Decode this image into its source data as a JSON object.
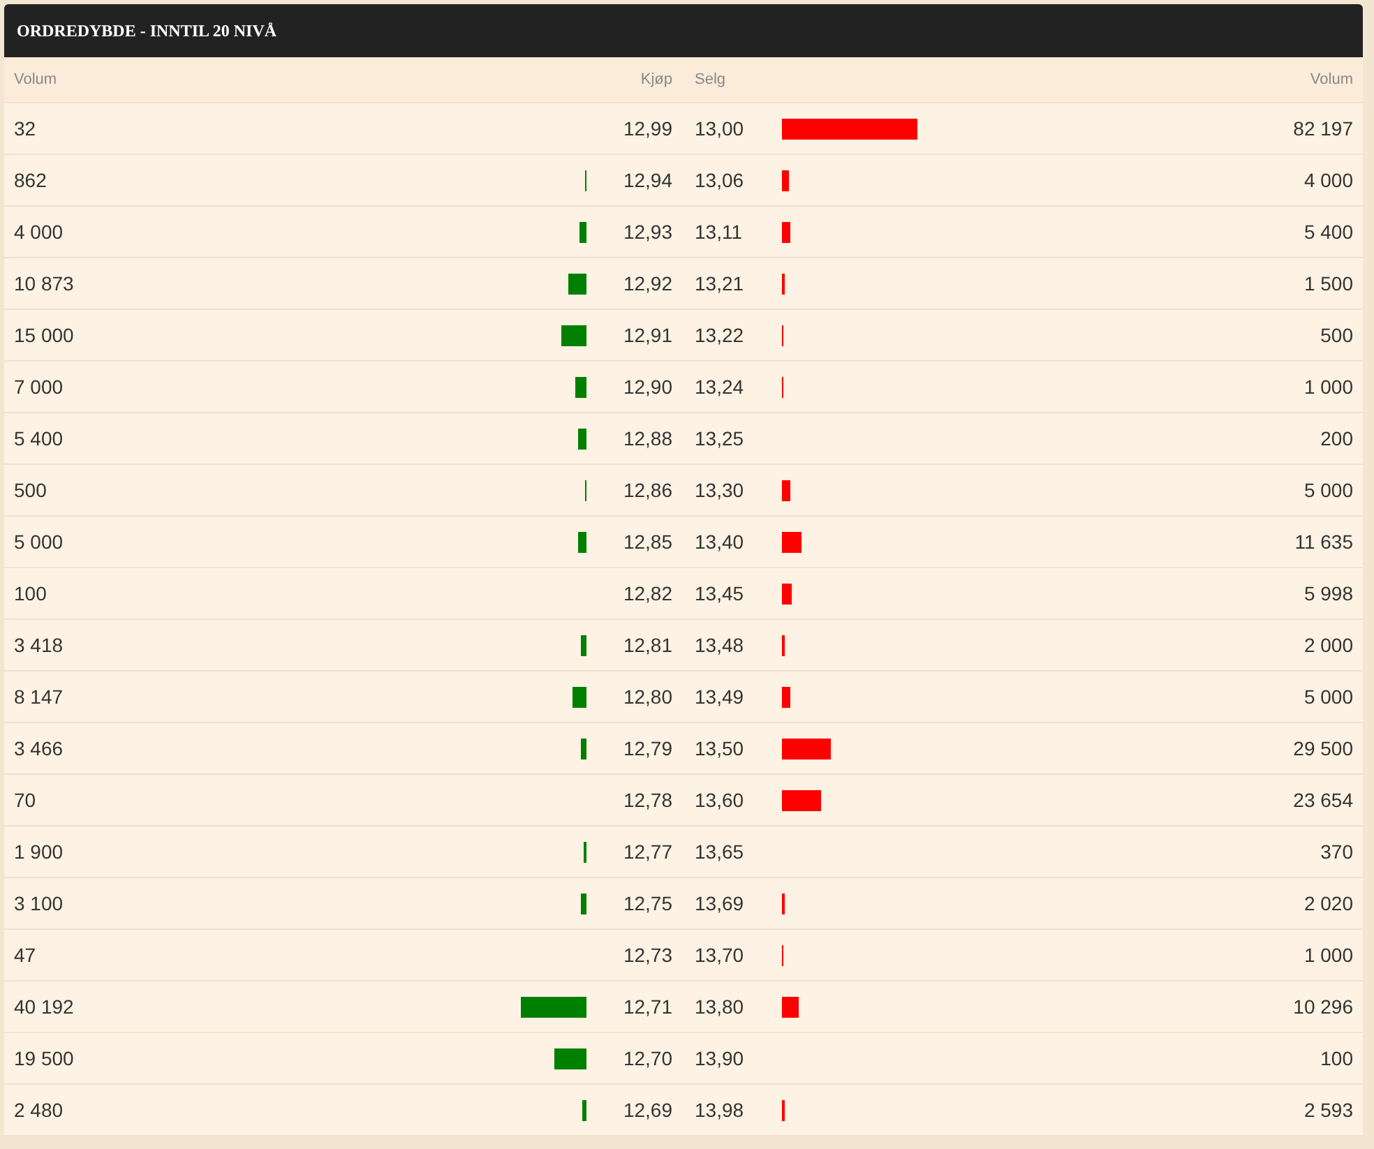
{
  "title": "ORDREDYBDE - INNTIL 20 NIVÅ",
  "columns": [
    "Volum",
    "Kjøp",
    "Selg",
    "Volum"
  ],
  "rows": [
    {
      "buy": {
        "volume": "32",
        "price": "12,99"
      },
      "sell": {
        "price": "13,00",
        "level": 0.97,
        "volume": "82 197"
      }
    },
    {
      "buy": {
        "volume": "862",
        "level": 0.01,
        "price": "12,94"
      },
      "sell": {
        "price": "13,06",
        "level": 0.05,
        "volume": "4 000"
      }
    },
    {
      "buy": {
        "volume": "4 000",
        "level": 0.05,
        "price": "12,93"
      },
      "sell": {
        "price": "13,11",
        "level": 0.06,
        "volume": "5 400"
      }
    },
    {
      "buy": {
        "volume": "10 873",
        "level": 0.13,
        "price": "12,92"
      },
      "sell": {
        "price": "13,21",
        "level": 0.02,
        "volume": "1 500"
      }
    },
    {
      "buy": {
        "volume": "15 000",
        "level": 0.18,
        "price": "12,91"
      },
      "sell": {
        "price": "13,22",
        "level": 0.01,
        "volume": "500"
      }
    },
    {
      "buy": {
        "volume": "7 000",
        "level": 0.08,
        "price": "12,90"
      },
      "sell": {
        "price": "13,24",
        "level": 0.01,
        "volume": "1 000"
      }
    },
    {
      "buy": {
        "volume": "5 400",
        "level": 0.06,
        "price": "12,88"
      },
      "sell": {
        "price": "13,25",
        "volume": "200"
      }
    },
    {
      "buy": {
        "volume": "500",
        "level": 0.01,
        "price": "12,86"
      },
      "sell": {
        "price": "13,30",
        "level": 0.06,
        "volume": "5 000"
      }
    },
    {
      "buy": {
        "volume": "5 000",
        "level": 0.06,
        "price": "12,85"
      },
      "sell": {
        "price": "13,40",
        "level": 0.14,
        "volume": "11 635"
      }
    },
    {
      "buy": {
        "volume": "100",
        "price": "12,82"
      },
      "sell": {
        "price": "13,45",
        "level": 0.07,
        "volume": "5 998"
      }
    },
    {
      "buy": {
        "volume": "3 418",
        "level": 0.04,
        "price": "12,81"
      },
      "sell": {
        "price": "13,48",
        "level": 0.02,
        "volume": "2 000"
      }
    },
    {
      "buy": {
        "volume": "8 147",
        "level": 0.1,
        "price": "12,80"
      },
      "sell": {
        "price": "13,49",
        "level": 0.06,
        "volume": "5 000"
      }
    },
    {
      "buy": {
        "volume": "3 466",
        "level": 0.04,
        "price": "12,79"
      },
      "sell": {
        "price": "13,50",
        "level": 0.35,
        "volume": "29 500"
      }
    },
    {
      "buy": {
        "volume": "70",
        "price": "12,78"
      },
      "sell": {
        "price": "13,60",
        "level": 0.28,
        "volume": "23 654"
      }
    },
    {
      "buy": {
        "volume": "1 900",
        "level": 0.02,
        "price": "12,77"
      },
      "sell": {
        "price": "13,65",
        "volume": "370"
      }
    },
    {
      "buy": {
        "volume": "3 100",
        "level": 0.04,
        "price": "12,75"
      },
      "sell": {
        "price": "13,69",
        "level": 0.02,
        "volume": "2 020"
      }
    },
    {
      "buy": {
        "volume": "47",
        "price": "12,73"
      },
      "sell": {
        "price": "13,70",
        "level": 0.01,
        "volume": "1 000"
      }
    },
    {
      "buy": {
        "volume": "40 192",
        "level": 0.47,
        "price": "12,71"
      },
      "sell": {
        "price": "13,80",
        "level": 0.12,
        "volume": "10 296"
      }
    },
    {
      "buy": {
        "volume": "19 500",
        "level": 0.23,
        "price": "12,70"
      },
      "sell": {
        "price": "13,90",
        "volume": "100"
      }
    },
    {
      "buy": {
        "volume": "2 480",
        "level": 0.03,
        "price": "12,69"
      },
      "sell": {
        "price": "13,98",
        "level": 0.02,
        "volume": "2 593"
      }
    }
  ]
}
